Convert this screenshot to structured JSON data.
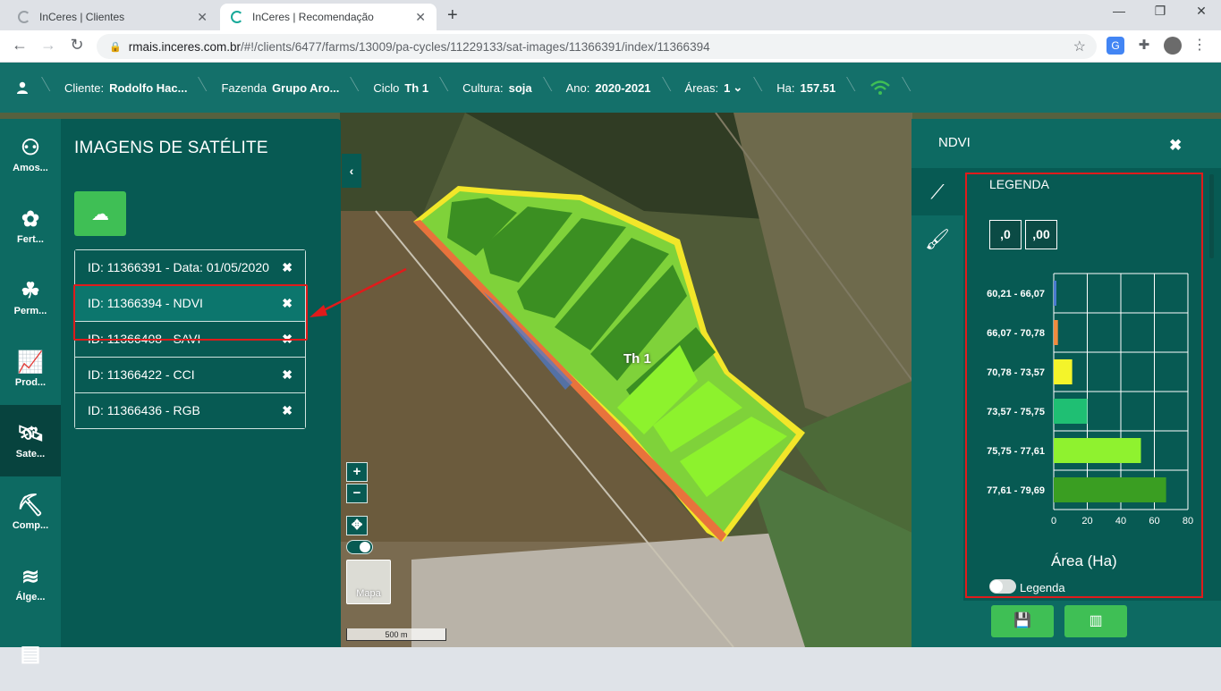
{
  "browser": {
    "tabs": [
      {
        "title": "InCeres | Clientes",
        "active": false
      },
      {
        "title": "InCeres | Recomendação",
        "active": true
      }
    ],
    "url_host": "rmais.inceres.com.br",
    "url_path": "/#!/clients/6477/farms/13009/pa-cycles/11229133/sat-images/11366391/index/11366394"
  },
  "header": {
    "cliente_label": "Cliente:",
    "cliente_value": "Rodolfo Hac...",
    "fazenda_label": "Fazenda",
    "fazenda_value": "Grupo Aro...",
    "ciclo_label": "Ciclo",
    "ciclo_value": "Th 1",
    "cultura_label": "Cultura:",
    "cultura_value": "soja",
    "ano_label": "Ano:",
    "ano_value": "2020-2021",
    "areas_label": "Áreas:",
    "areas_value": "1",
    "ha_label": "Ha:",
    "ha_value": "157.51"
  },
  "rail": [
    {
      "label": "Amos...",
      "icon": "samples-icon"
    },
    {
      "label": "Fert...",
      "icon": "fertility-icon"
    },
    {
      "label": "Perm...",
      "icon": "permanent-crop-icon"
    },
    {
      "label": "Prod...",
      "icon": "productivity-icon"
    },
    {
      "label": "Sate...",
      "icon": "satellite-icon",
      "active": true
    },
    {
      "label": "Comp...",
      "icon": "compaction-icon"
    },
    {
      "label": "Álge...",
      "icon": "layers-icon"
    },
    {
      "label": "",
      "icon": "report-icon"
    }
  ],
  "left_panel": {
    "title": "IMAGENS DE SATÉLITE",
    "images": [
      {
        "label": "ID: 11366391 - Data: 01/05/2020"
      },
      {
        "label": "ID: 11366394 - NDVI",
        "selected": true
      },
      {
        "label": "ID: 11366408 - SAVI"
      },
      {
        "label": "ID: 11366422 - CCI"
      },
      {
        "label": "ID: 11366436 - RGB"
      }
    ]
  },
  "map": {
    "field_label": "Th 1",
    "zoom_in": "+",
    "zoom_out": "−",
    "basemap_label": "Mapa",
    "scale_label": "500 m"
  },
  "right_panel": {
    "title": "NDVI",
    "legend_title": "LEGENDA",
    "decimals_less": ",0",
    "decimals_more": ",00",
    "legend_toggle_label": "Legenda"
  },
  "chart_data": {
    "type": "bar",
    "orientation": "horizontal",
    "categories": [
      "60,21 - 66,07",
      "66,07 - 70,78",
      "70,78 - 73,57",
      "73,57 - 75,75",
      "75,75 - 77,61",
      "77,61 - 79,69"
    ],
    "values": [
      1,
      2.5,
      11,
      20,
      52,
      67
    ],
    "colors": [
      "#4a7bd1",
      "#f08b3e",
      "#f4f42a",
      "#1fbf73",
      "#8ff22f",
      "#3a9e22"
    ],
    "xlabel": "Área (Ha)",
    "xlim": [
      0,
      80
    ],
    "xticks": [
      0,
      20,
      40,
      60,
      80
    ],
    "grid": true
  },
  "colors": {
    "header_bg": "#14706a",
    "panel_bg": "#075a53",
    "accent_green": "#3fbf55",
    "highlight_red": "#e01b1b"
  }
}
